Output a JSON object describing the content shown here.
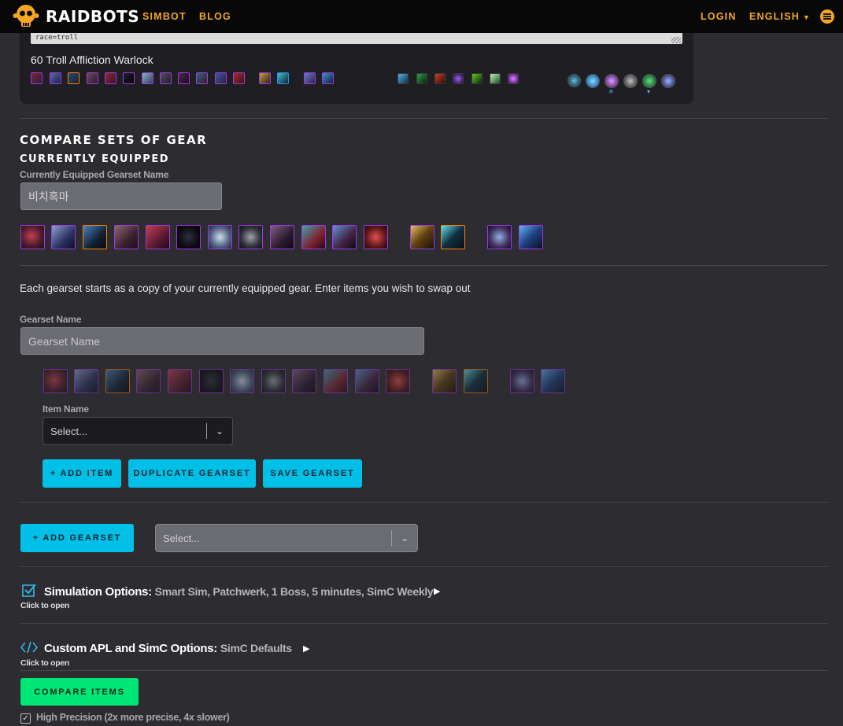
{
  "nav": {
    "brand": "RAIDBOTS",
    "simbot": "SIMBOT",
    "blog": "BLOG",
    "login": "LOGIN",
    "language": "ENGLISH",
    "colors": {
      "accent": "#f5a623",
      "bar": "#070708"
    }
  },
  "character": {
    "textarea_snippet": "race=troll",
    "name": "60 Troll Affliction Warlock"
  },
  "compare": {
    "section_title": "COMPARE SETS OF GEAR",
    "currently_equipped_heading": "CURRENTLY EQUIPPED",
    "gearset_name_label": "Currently Equipped Gearset Name",
    "gearset_name_value": "비치흑마",
    "help_text": "Each gearset starts as a copy of your currently equipped gear. Enter items you wish to swap out",
    "new_gearset_label": "Gearset Name",
    "new_gearset_placeholder": "Gearset Name",
    "item_name_label": "Item Name",
    "item_select_placeholder": "Select...",
    "add_item_button": "+ ADD ITEM",
    "duplicate_button": "DUPLICATE GEARSET",
    "save_button": "SAVE GEARSET",
    "add_gearset_button": "+ ADD GEARSET",
    "gearset_select_placeholder": "Select..."
  },
  "simulation_options": {
    "title": "Simulation Options:",
    "summary": "Smart Sim, Patchwerk, 1 Boss, 5 minutes, SimC Weekly",
    "hint": "Click to open"
  },
  "custom_apl": {
    "title": "Custom APL and SimC Options:",
    "summary": "SimC Defaults",
    "hint": "Click to open"
  },
  "compare_button": "COMPARE ITEMS",
  "high_precision": {
    "label": "High Precision (2x more precise, 4x slower)",
    "checked": true
  },
  "colors": {
    "background": "#2c2c31",
    "button_cyan": "#00c0e8",
    "button_green": "#00e676",
    "epic_border": "#a335ee",
    "legendary_border": "#ff8000"
  }
}
